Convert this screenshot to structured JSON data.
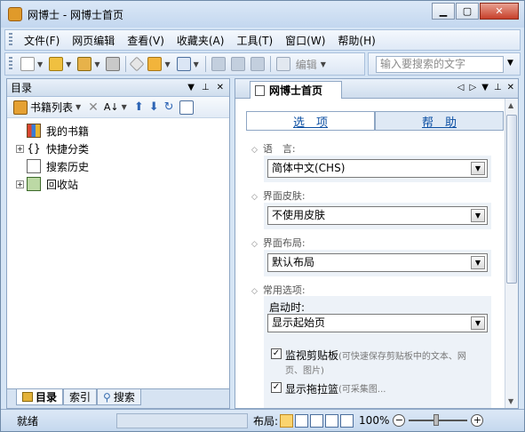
{
  "window": {
    "title": "网博士 - 网博士首页"
  },
  "menu": {
    "items": [
      "文件(F)",
      "网页编辑",
      "查看(V)",
      "收藏夹(A)",
      "工具(T)",
      "窗口(W)",
      "帮助(H)"
    ]
  },
  "toolbar": {
    "edit_label": "编辑",
    "search_placeholder": "输入要搜索的文字"
  },
  "left_pane": {
    "title": "目录",
    "list_label": "书籍列表",
    "tree": [
      "我的书籍",
      "快捷分类",
      "搜索历史",
      "回收站"
    ],
    "tabs": [
      "目录",
      "索引",
      "搜索"
    ]
  },
  "right_pane": {
    "doc_tab": "网博士首页",
    "subtabs": [
      "选　项",
      "帮　助"
    ],
    "sections": {
      "language": {
        "label": "语　言:",
        "value": "简体中文(CHS)"
      },
      "skin": {
        "label": "界面皮肤:",
        "value": "不使用皮肤"
      },
      "layout": {
        "label": "界面布局:",
        "value": "默认布局"
      },
      "common": {
        "label": "常用选项:"
      }
    },
    "startup_label": "启动时:",
    "startup_value": "显示起始页",
    "options": [
      {
        "label": "监视剪贴板",
        "hint": "(可快速保存剪贴板中的文本、网",
        "hint2": "页、图片)"
      },
      {
        "label": "显示拖拉篮",
        "hint": "(可采集图..."
      }
    ]
  },
  "status": {
    "text": "就绪",
    "layout_label": "布局:",
    "zoom": "100%"
  },
  "colors": {
    "accent_link": "#0b4ea2",
    "frame": "#8ea6c4"
  }
}
